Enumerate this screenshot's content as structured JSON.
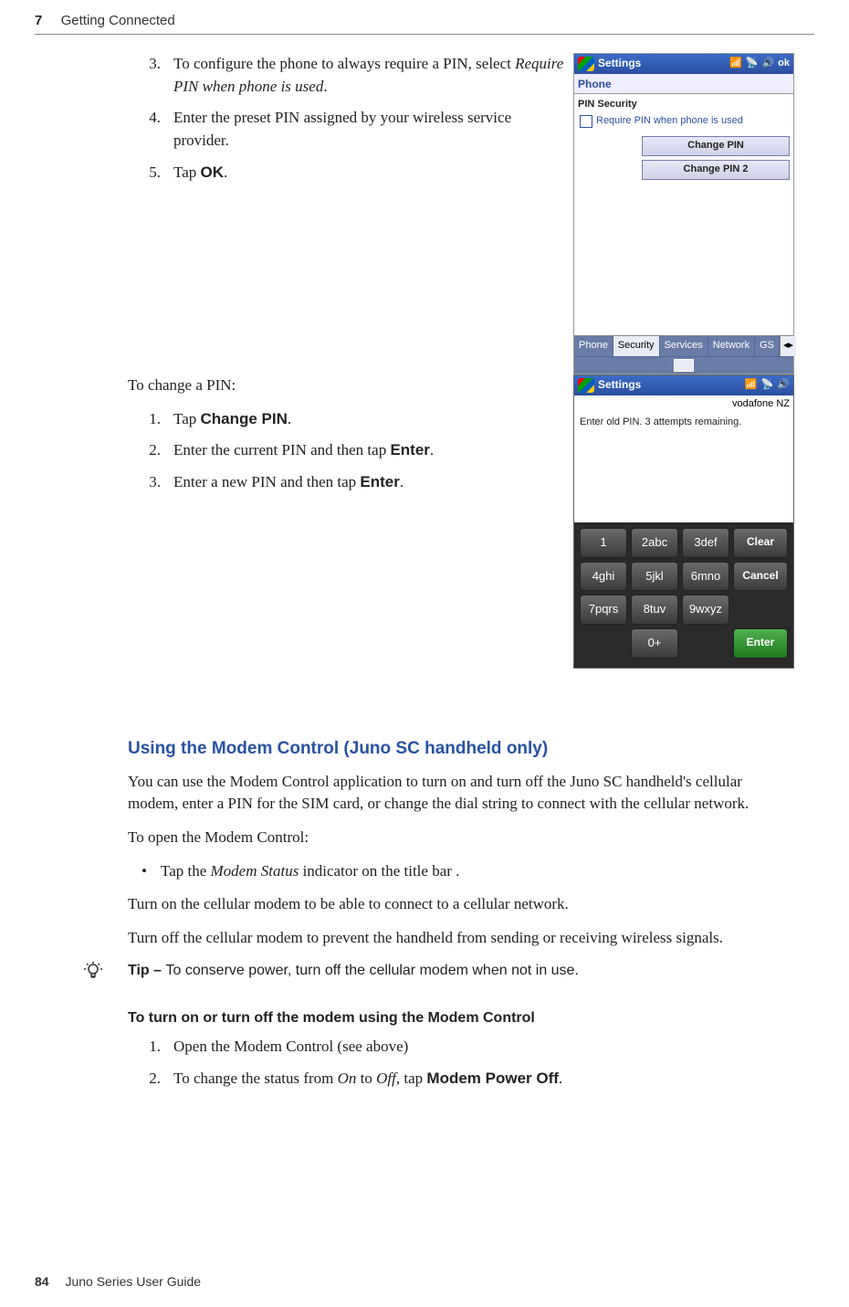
{
  "header": {
    "chapter": "7",
    "title": "Getting Connected"
  },
  "footer": {
    "page": "84",
    "book": "Juno Series User Guide"
  },
  "steps_a": [
    {
      "n": "3.",
      "pre": "To configure the phone to always require a PIN, select ",
      "ital": "Require PIN when phone is used",
      "post": "."
    },
    {
      "n": "4.",
      "pre": "Enter the preset PIN assigned by your wireless service provider.",
      "ital": "",
      "post": ""
    },
    {
      "n": "5.",
      "pre": "Tap ",
      "bold": "OK",
      "post": "."
    }
  ],
  "change_intro": "To change a PIN:",
  "steps_b": [
    {
      "n": "1.",
      "pre": "Tap ",
      "bold": "Change PIN",
      "post": "."
    },
    {
      "n": "2.",
      "pre": "Enter the current PIN and then tap ",
      "bold": "Enter",
      "post": "."
    },
    {
      "n": "3.",
      "pre": "Enter a new PIN and then tap ",
      "bold": "Enter",
      "post": "."
    }
  ],
  "h3": "Using the Modem Control (Juno SC handheld only)",
  "p1": "You can use the Modem Control application to turn on and turn off the Juno SC handheld's cellular modem, enter a PIN for the SIM card, or change the dial string to connect with the cellular network.",
  "p2": "To open the Modem Control:",
  "bullet": {
    "pre": "Tap the ",
    "ital": "Modem Status",
    "post": " indicator on the title bar ."
  },
  "p3": "Turn on the cellular modem to be able to connect to a cellular network.",
  "p4": "Turn off the cellular modem to prevent the handheld from sending or receiving wireless signals.",
  "tip": {
    "label": "Tip – ",
    "text": "To conserve power, turn off the cellular modem when not in use."
  },
  "h4": "To turn on or turn off the modem using the Modem Control",
  "steps_c": [
    {
      "n": "1.",
      "pre": "Open the Modem Control (see above)",
      "post": ""
    },
    {
      "n": "2.",
      "pre": "To change the status from ",
      "ital": "On",
      "mid": " to ",
      "ital2": "Off",
      "mid2": ", tap ",
      "bold": "Modem Power Off",
      "post": "."
    }
  ],
  "shot1": {
    "title": "Settings",
    "ok": "ok",
    "icons": [
      "signal-icon",
      "antenna-icon",
      "speaker-icon"
    ],
    "heading": "Phone",
    "group": "PIN Security",
    "checkbox": "Require PIN when phone is used",
    "btn1": "Change PIN",
    "btn2": "Change PIN 2",
    "tabs": [
      "Phone",
      "Security",
      "Services",
      "Network",
      "GS"
    ],
    "active_tab": 1
  },
  "shot2": {
    "title": "Settings",
    "icons": [
      "signal-icon",
      "antenna-icon",
      "speaker-icon"
    ],
    "carrier": "vodafone NZ",
    "prompt": "Enter old PIN.  3 attempts remaining.",
    "keys": [
      [
        "1",
        "2abc",
        "3def"
      ],
      [
        "4ghi",
        "5jkl",
        "6mno"
      ],
      [
        "7pqrs",
        "8tuv",
        "9wxyz"
      ],
      [
        "",
        "0+",
        ""
      ]
    ],
    "side": [
      "Clear",
      "Cancel",
      "",
      "Enter"
    ]
  }
}
